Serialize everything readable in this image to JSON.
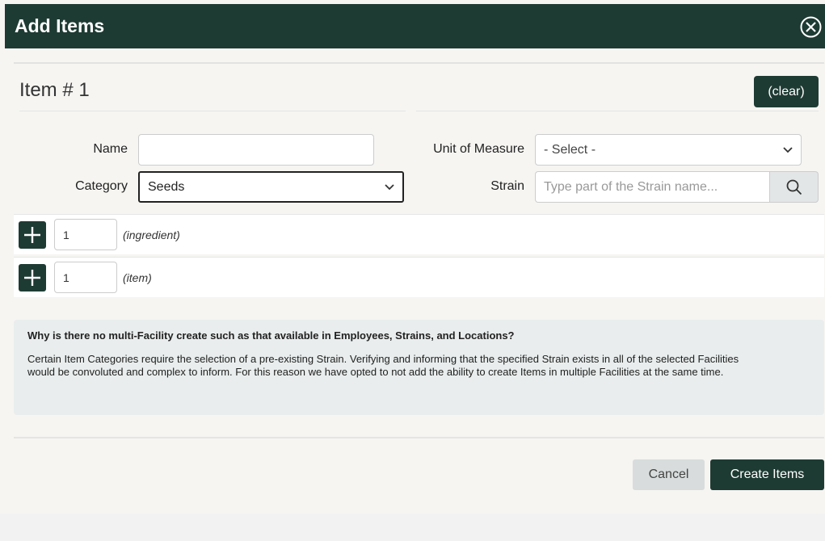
{
  "dialog": {
    "title": "Add Items"
  },
  "item": {
    "heading": "Item # 1",
    "clear_label": "(clear)",
    "name_label": "Name",
    "name_value": "",
    "category_label": "Category",
    "category_value": "Seeds",
    "uom_label": "Unit of Measure",
    "uom_value": "- Select -",
    "strain_label": "Strain",
    "strain_placeholder": "Type part of the Strain name..."
  },
  "rows": [
    {
      "qty": "1",
      "note": "(ingredient)"
    },
    {
      "qty": "1",
      "note": "(item)"
    }
  ],
  "info": {
    "question": "Why is there no multi-Facility create such as that available in Employees, Strains, and Locations?",
    "body": "Certain Item Categories require the selection of a pre-existing Strain. Verifying and informing that the specified Strain exists in all of the selected Facilities would be convoluted and complex to inform. For this reason we have opted to not add the ability to create Items in multiple Facilities at the same time."
  },
  "actions": {
    "cancel_label": "Cancel",
    "create_label": "Create Items"
  },
  "icons": {
    "close": "close-circle-x-icon",
    "search": "search-icon",
    "plus": "plus-icon",
    "chevron": "chevron-down-icon"
  },
  "colors": {
    "primary": "#1e3b33",
    "info_bg": "#e9eded"
  }
}
